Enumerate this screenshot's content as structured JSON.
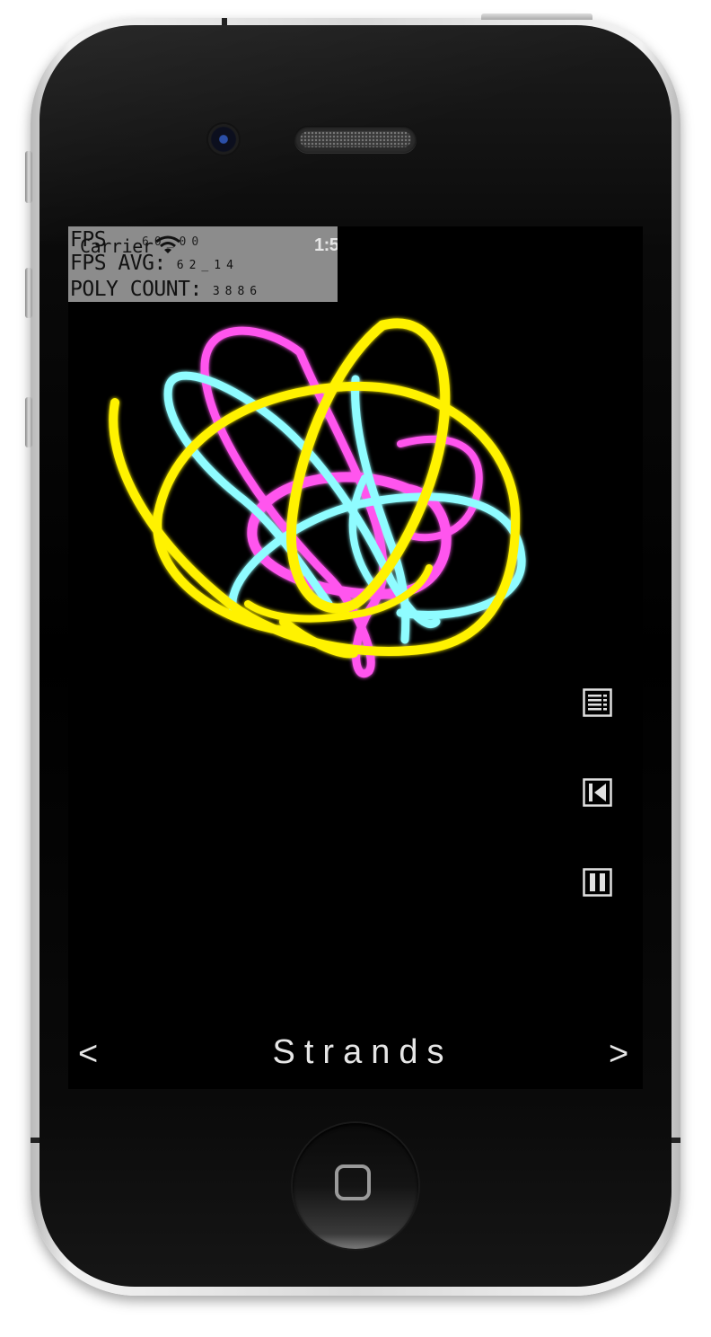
{
  "debug": {
    "fps_label": "FPS",
    "fps_value": "60_00",
    "fps_avg_label": "FPS AVG:",
    "fps_avg_value": "62_14",
    "poly_label": "POLY COUNT:",
    "poly_value": "3886"
  },
  "status_bar": {
    "carrier": "Carrier",
    "time": "1:5"
  },
  "controls": {
    "menu_icon": "list-icon",
    "restart_icon": "skip-back-icon",
    "pause_icon": "pause-icon"
  },
  "nav": {
    "prev": "<",
    "next": ">",
    "title": "Strands"
  },
  "colors": {
    "strand_yellow": "#fff200",
    "strand_cyan": "#8ffcff",
    "strand_magenta": "#ff55ee",
    "debug_panel": "#8c8c8c"
  }
}
